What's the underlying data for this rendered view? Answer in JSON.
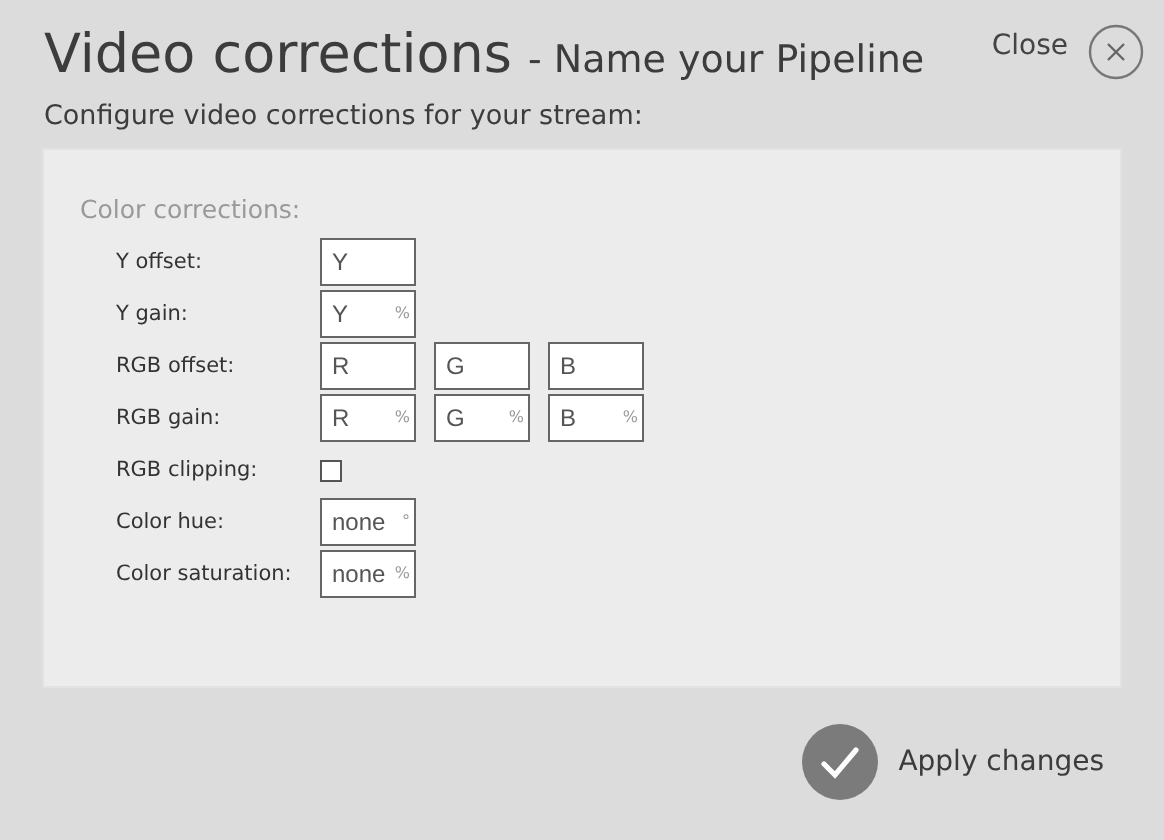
{
  "title": "Video corrections",
  "subtitle": "- Name your Pipeline",
  "close_label": "Close",
  "description": "Configure video corrections for your stream:",
  "section": {
    "title": "Color corrections:",
    "rows": [
      {
        "kind": "fields",
        "label": "Y offset:",
        "fields": [
          {
            "placeholder": "Y"
          }
        ]
      },
      {
        "kind": "fields",
        "label": "Y gain:",
        "fields": [
          {
            "placeholder": "Y",
            "unit": "%"
          }
        ]
      },
      {
        "kind": "fields",
        "label": "RGB offset:",
        "fields": [
          {
            "placeholder": "R"
          },
          {
            "placeholder": "G"
          },
          {
            "placeholder": "B"
          }
        ]
      },
      {
        "kind": "fields",
        "label": "RGB gain:",
        "fields": [
          {
            "placeholder": "R",
            "unit": "%"
          },
          {
            "placeholder": "G",
            "unit": "%"
          },
          {
            "placeholder": "B",
            "unit": "%"
          }
        ]
      },
      {
        "kind": "checkbox",
        "label": "RGB clipping:",
        "checked": false
      },
      {
        "kind": "fields",
        "label": "Color hue:",
        "fields": [
          {
            "placeholder": "none",
            "unit": "°"
          }
        ]
      },
      {
        "kind": "fields",
        "label": "Color saturation:",
        "fields": [
          {
            "placeholder": "none",
            "unit": "%"
          }
        ]
      }
    ]
  },
  "apply_label": "Apply changes"
}
